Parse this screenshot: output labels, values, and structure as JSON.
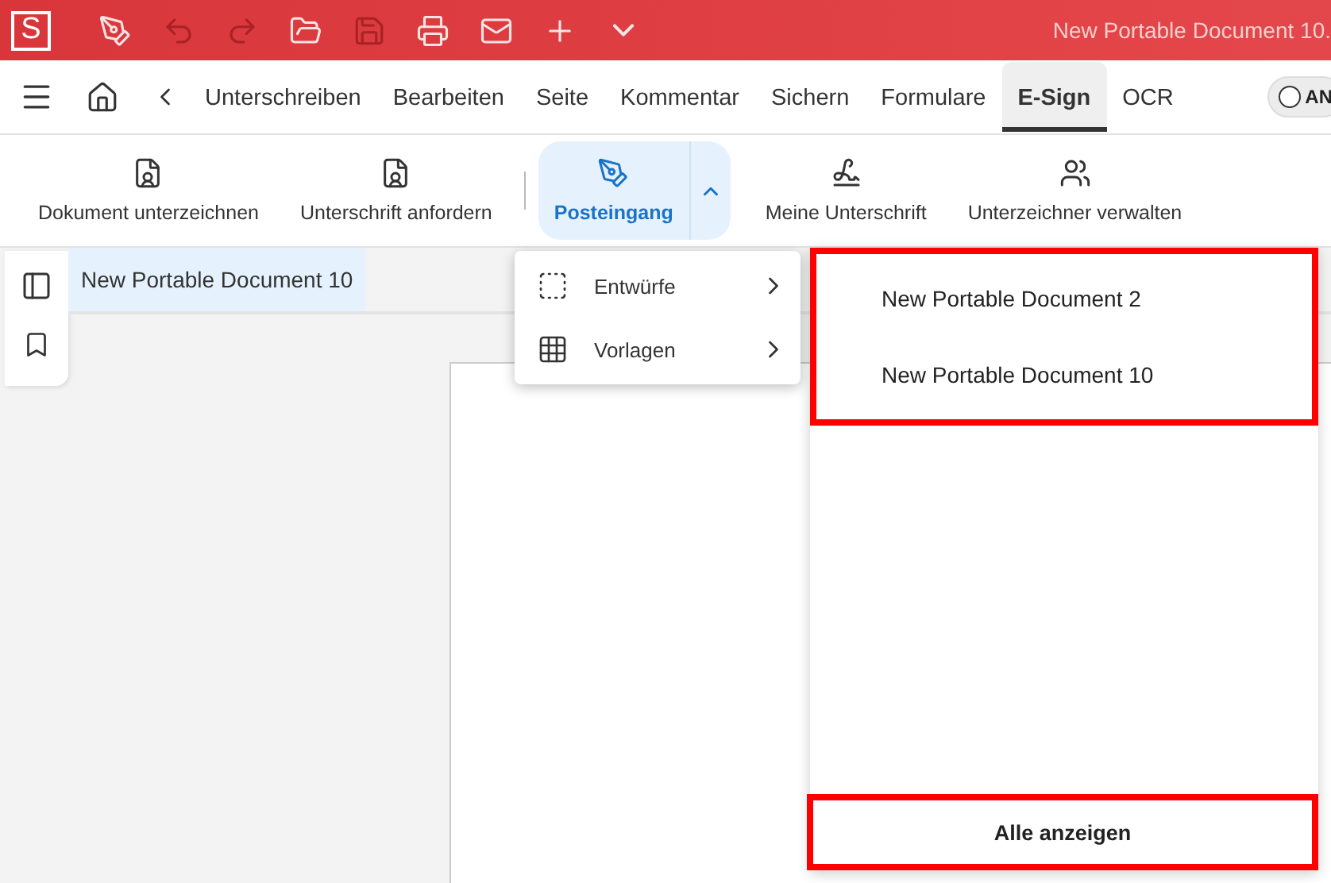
{
  "title_bar": {
    "logo": "S",
    "title": "New Portable Document 10.",
    "quick_tools": [
      {
        "kind": "pen",
        "disabled": false
      },
      {
        "kind": "undo",
        "disabled": true
      },
      {
        "kind": "redo",
        "disabled": true
      },
      {
        "kind": "open",
        "disabled": false
      },
      {
        "kind": "save",
        "disabled": true
      },
      {
        "kind": "print",
        "disabled": false
      },
      {
        "kind": "mail",
        "disabled": false
      },
      {
        "kind": "add",
        "disabled": false
      },
      {
        "kind": "more",
        "disabled": false
      }
    ]
  },
  "menu_tabs": [
    {
      "label": "Unterschreiben",
      "selected": false
    },
    {
      "label": "Bearbeiten",
      "selected": false
    },
    {
      "label": "Seite",
      "selected": false
    },
    {
      "label": "Kommentar",
      "selected": false
    },
    {
      "label": "Sichern",
      "selected": false
    },
    {
      "label": "Formulare",
      "selected": false
    },
    {
      "label": "E-Sign",
      "selected": true
    },
    {
      "label": "OCR",
      "selected": false
    }
  ],
  "toggle": {
    "label": "AN",
    "on": false
  },
  "ribbon": [
    {
      "kind": "sign-doc",
      "label": "Dokument unterzeichnen",
      "selected": false
    },
    {
      "kind": "request",
      "label": "Unterschrift anfordern",
      "selected": false
    },
    {
      "kind": "inbox",
      "label": "Posteingang",
      "selected": true,
      "expanded": true
    },
    {
      "kind": "signature",
      "label": "Meine Unterschrift",
      "selected": false
    },
    {
      "kind": "signers",
      "label": "Unterzeichner verwalten",
      "selected": false
    }
  ],
  "document_tabs": [
    {
      "label": "New Portable Document 10",
      "selected": true
    }
  ],
  "dropdown_menu": [
    {
      "kind": "drafts",
      "label": "Entwürfe"
    },
    {
      "kind": "templates",
      "label": "Vorlagen"
    }
  ],
  "recent_documents": {
    "highlighted": true,
    "items": [
      {
        "label": "New Portable Document 2"
      },
      {
        "label": "New Portable Document 10"
      }
    ]
  },
  "show_all": {
    "label": "Alle anzeigen",
    "highlighted": true
  }
}
